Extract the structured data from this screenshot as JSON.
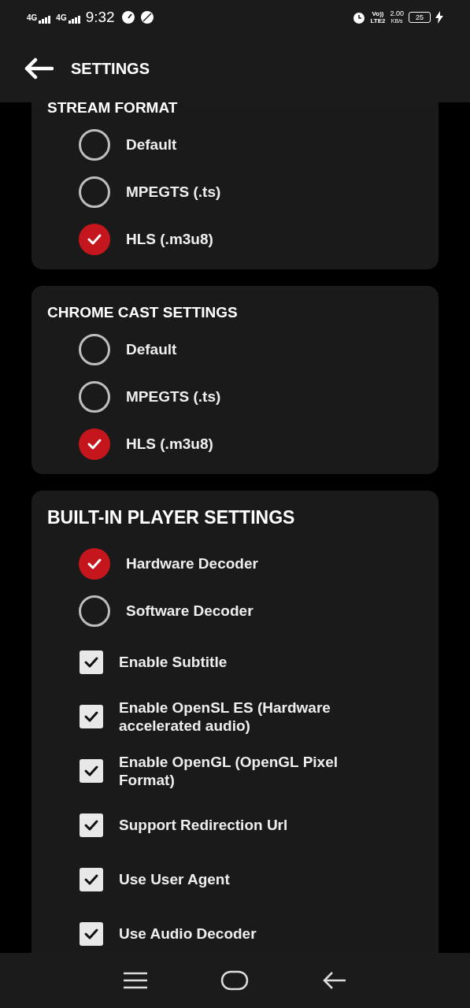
{
  "status_bar": {
    "network_1": "4G",
    "network_2": "4G",
    "time": "9:32",
    "volte": "Vo))",
    "lte": "LTE2",
    "speed": "2.00",
    "speed_unit": "KB/s",
    "battery": "25"
  },
  "header": {
    "title": "SETTINGS"
  },
  "sections": [
    {
      "title": "STREAM FORMAT",
      "large": false,
      "items": [
        {
          "kind": "radio",
          "label": "Default",
          "selected": false
        },
        {
          "kind": "radio",
          "label": "MPEGTS (.ts)",
          "selected": false
        },
        {
          "kind": "radio",
          "label": "HLS (.m3u8)",
          "selected": true
        }
      ]
    },
    {
      "title": "CHROME CAST SETTINGS",
      "large": false,
      "items": [
        {
          "kind": "radio",
          "label": "Default",
          "selected": false
        },
        {
          "kind": "radio",
          "label": "MPEGTS (.ts)",
          "selected": false
        },
        {
          "kind": "radio",
          "label": "HLS (.m3u8)",
          "selected": true
        }
      ]
    },
    {
      "title": "BUILT-IN PLAYER SETTINGS",
      "large": true,
      "items": [
        {
          "kind": "radio",
          "label": "Hardware Decoder",
          "selected": true
        },
        {
          "kind": "radio",
          "label": "Software Decoder",
          "selected": false
        },
        {
          "kind": "checkbox",
          "label": "Enable Subtitle",
          "checked": true
        },
        {
          "kind": "checkbox",
          "label": "Enable OpenSL ES (Hardware accelerated audio)",
          "checked": true
        },
        {
          "kind": "checkbox",
          "label": "Enable OpenGL (OpenGL Pixel Format)",
          "checked": true
        },
        {
          "kind": "checkbox",
          "label": "Support Redirection Url",
          "checked": true
        },
        {
          "kind": "checkbox",
          "label": "Use User Agent",
          "checked": true
        },
        {
          "kind": "checkbox",
          "label": "Use Audio Decoder",
          "checked": true
        }
      ]
    }
  ]
}
